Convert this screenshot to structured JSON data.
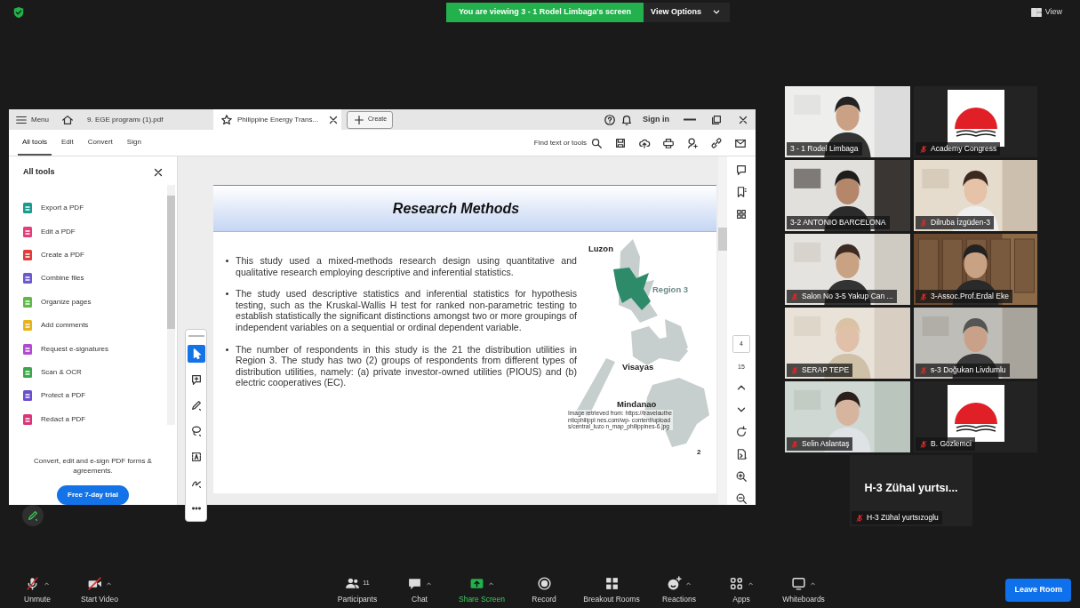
{
  "top_bar": {
    "banner": "You are viewing 3 - 1 Rodel Limbaga's screen",
    "view_options": "View Options",
    "view": "View"
  },
  "acrobat": {
    "menu": "Menu",
    "doc_tabs": [
      {
        "title": "9. EGE programı (1).pdf",
        "selected": false
      },
      {
        "title": "Philippine Energy Trans...",
        "selected": true
      }
    ],
    "create": "Create",
    "sign_in": "Sign in",
    "tool_tabs": [
      {
        "label": "All tools",
        "selected": true
      },
      {
        "label": "Edit",
        "selected": false
      },
      {
        "label": "Convert",
        "selected": false
      },
      {
        "label": "Sign",
        "selected": false
      }
    ],
    "find": "Find text or tools",
    "panel": {
      "title": "All tools",
      "tools": [
        {
          "label": "Export a PDF",
          "color": "#1a9b8e"
        },
        {
          "label": "Edit a PDF",
          "color": "#e0407b"
        },
        {
          "label": "Create a PDF",
          "color": "#e03c3c"
        },
        {
          "label": "Combine files",
          "color": "#6a5acd"
        },
        {
          "label": "Organize pages",
          "color": "#5fb84a"
        },
        {
          "label": "Add comments",
          "color": "#e8b21a"
        },
        {
          "label": "Request e-signatures",
          "color": "#b04ad0"
        },
        {
          "label": "Scan & OCR",
          "color": "#3aa84a"
        },
        {
          "label": "Protect a PDF",
          "color": "#6b4fcf"
        },
        {
          "label": "Redact a PDF",
          "color": "#d9367a"
        }
      ],
      "promo": "Convert, edit and e-sign PDF forms & agreements.",
      "trial": "Free 7-day trial"
    },
    "annotation_tools": [
      {
        "kind": "select",
        "selected": true
      },
      {
        "kind": "comment",
        "selected": false
      },
      {
        "kind": "pen",
        "selected": false
      },
      {
        "kind": "lasso",
        "selected": false
      },
      {
        "kind": "text",
        "selected": false
      },
      {
        "kind": "sign",
        "selected": false
      },
      {
        "kind": "more",
        "selected": false
      }
    ],
    "page": {
      "title": "Research Methods",
      "bullets": [
        "This study used a mixed-methods research design using quantitative and qualitative research employing descriptive and inferential statistics.",
        "The study used descriptive statistics and inferential statistics for hypothesis testing, such as the Kruskal-Wallis H test for ranked non-parametric testing to establish statistically the significant distinctions amongst two or more groupings of independent variables on a sequential or ordinal dependent variable.",
        "The number of respondents in this study is the 21 the distribution utilities in Region 3. The study has two (2) groups of respondents from different types of distribution utilities, namely: (a) private investor-owned utilities (PIOUS) and (b) electric cooperatives (EC)."
      ],
      "map_labels": [
        "Luzon",
        "Region 3",
        "Visayas",
        "Mindanao"
      ],
      "caption": "Image retrieved from: https://travelauthenticphilippl nes.com/wp- content/uploads/central_luzo n_map_philippines-6.jpg",
      "page_number": "2"
    },
    "page_nav": {
      "current": "4",
      "total": "15"
    }
  },
  "participants": [
    {
      "name": "3 - 1 Rodel Limbaga",
      "kind": "video",
      "muted": false,
      "speaking": true
    },
    {
      "name": "Academy Congress",
      "kind": "logo",
      "muted": true,
      "speaking": false
    },
    {
      "name": "3-2 ANTONIO BARCELONA",
      "kind": "video",
      "muted": false,
      "speaking": false
    },
    {
      "name": "Dilruba İzgüden-3",
      "kind": "video",
      "muted": true,
      "speaking": false
    },
    {
      "name": "Salon No 3-5 Yakup Can ...",
      "kind": "video",
      "muted": true,
      "speaking": false
    },
    {
      "name": "3-Assoc.Prof.Erdal Eke",
      "kind": "video",
      "muted": true,
      "speaking": false
    },
    {
      "name": "SERAP TEPE",
      "kind": "video",
      "muted": true,
      "speaking": false
    },
    {
      "name": "s-3 Doğukan Livdumlu",
      "kind": "video",
      "muted": true,
      "speaking": false
    },
    {
      "name": "Selin Aslantaş",
      "kind": "video",
      "muted": true,
      "speaking": false
    },
    {
      "name": "B. Gözlemci",
      "kind": "logo",
      "muted": true,
      "speaking": false
    },
    {
      "name": "H-3 Zühal yurtsızoglu",
      "kind": "name",
      "display": "H-3 Zühal yurtsı...",
      "muted": true,
      "speaking": false
    }
  ],
  "toolbar": [
    {
      "label": "Unmute",
      "kind": "mic",
      "off": true,
      "caret": true
    },
    {
      "label": "Start Video",
      "kind": "video",
      "off": true,
      "caret": true
    },
    {
      "label": "Participants",
      "kind": "participants",
      "count": "11",
      "caret": false
    },
    {
      "label": "Chat",
      "kind": "chat",
      "caret": true
    },
    {
      "label": "Share Screen",
      "kind": "share",
      "caret": true
    },
    {
      "label": "Record",
      "kind": "record",
      "caret": false
    },
    {
      "label": "Breakout Rooms",
      "kind": "breakout",
      "caret": false
    },
    {
      "label": "Reactions",
      "kind": "reactions",
      "caret": true
    },
    {
      "label": "Apps",
      "kind": "apps",
      "caret": true
    },
    {
      "label": "Whiteboards",
      "kind": "whiteboard",
      "caret": true
    }
  ],
  "leave": "Leave Room"
}
